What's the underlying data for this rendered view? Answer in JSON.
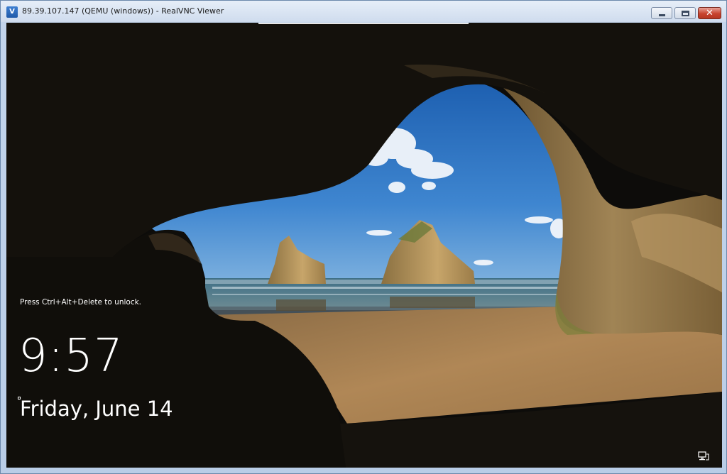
{
  "window": {
    "title": "89.39.107.147 (QEMU (windows)) - RealVNC Viewer",
    "app_icon": "realvnc-icon",
    "controls": {
      "minimize_icon": "minimize-icon",
      "maximize_icon": "maximize-icon",
      "close_icon": "close-icon",
      "close_glyph": "✕"
    }
  },
  "lockscreen": {
    "unlock_hint": "Press Ctrl+Alt+Delete to unlock.",
    "time": "9:57",
    "date": "Friday, June 14",
    "network_icon": "network-monitor-icon"
  },
  "colors": {
    "close_button": "#c8442f",
    "text": "#ffffff"
  }
}
